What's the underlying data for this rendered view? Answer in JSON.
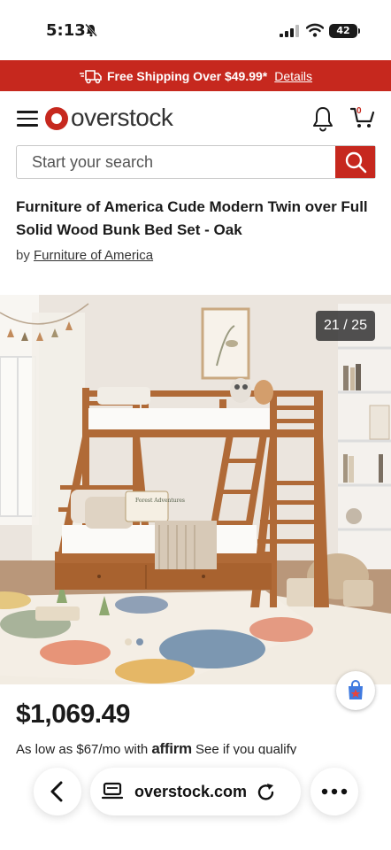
{
  "status_bar": {
    "time": "5:13",
    "battery": "42",
    "icons": [
      "bell-slash-icon",
      "signal-icon",
      "wifi-icon",
      "battery-icon"
    ]
  },
  "promo": {
    "text": "Free Shipping Over $49.99*",
    "link": "Details",
    "icon": "truck-icon",
    "color": "#c6281e"
  },
  "header": {
    "logo_text": "overstock",
    "cart_count": "0",
    "icons": [
      "menu-icon",
      "bell-icon",
      "cart-icon"
    ]
  },
  "search": {
    "placeholder": "Start your search",
    "icon": "search-icon"
  },
  "product": {
    "title": "Furniture of America Cude Modern Twin over Full Solid Wood Bunk Bed Set - Oak",
    "by_prefix": "by",
    "brand": "Furniture of America",
    "image_counter": "21 / 25",
    "book_text": "Forest Adventures",
    "price": "$1,069.49",
    "financing_prefix": "As low as $67/mo with",
    "financing_brand": "affirm",
    "financing_suffix": "See if you qualify"
  },
  "browser": {
    "url": "overstock.com",
    "icons": [
      "back-icon",
      "tabs-icon",
      "reload-icon",
      "more-icon"
    ]
  }
}
